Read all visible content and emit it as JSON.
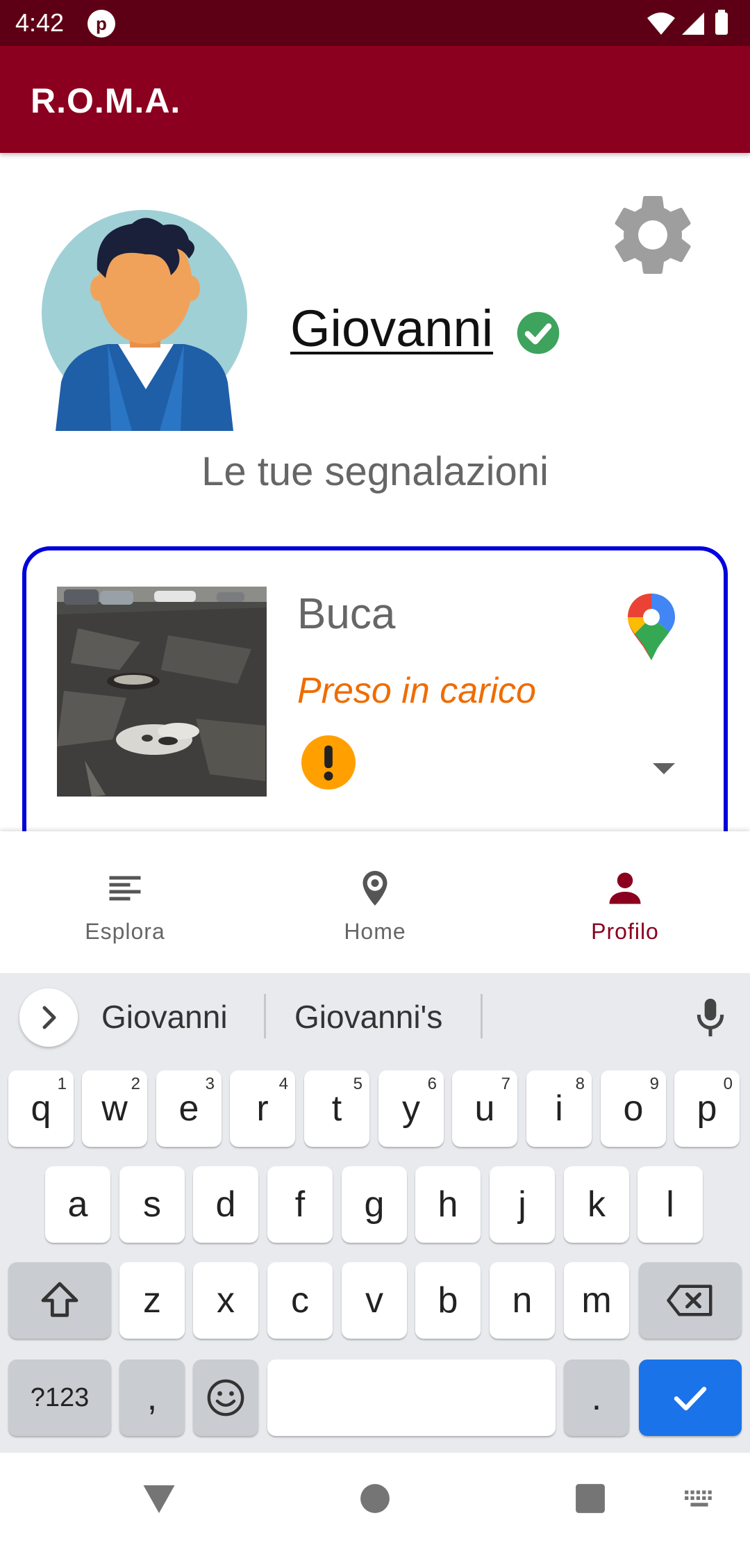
{
  "status_bar": {
    "time": "4:42",
    "app_icon_letter": "p"
  },
  "app_bar": {
    "title": "R.O.M.A."
  },
  "profile": {
    "name": "Giovanni",
    "verified_icon": "check-circle-icon",
    "settings_icon": "gear-icon",
    "section_title": "Le tue segnalazioni"
  },
  "reports": [
    {
      "type": "Buca",
      "status": "Preso in carico",
      "status_color": "#ef6c00",
      "priority_icon": "exclamation-circle-icon",
      "map_icon": "google-maps-pin-icon"
    }
  ],
  "bottom_nav": {
    "items": [
      {
        "label": "Esplora",
        "icon": "list-icon",
        "active": false
      },
      {
        "label": "Home",
        "icon": "location-pin-icon",
        "active": false
      },
      {
        "label": "Profilo",
        "icon": "person-icon",
        "active": true
      }
    ],
    "active_color": "#8b001e"
  },
  "keyboard": {
    "suggestions": [
      "Giovanni",
      "Giovanni's"
    ],
    "row1": [
      {
        "key": "q",
        "hint": "1"
      },
      {
        "key": "w",
        "hint": "2"
      },
      {
        "key": "e",
        "hint": "3"
      },
      {
        "key": "r",
        "hint": "4"
      },
      {
        "key": "t",
        "hint": "5"
      },
      {
        "key": "y",
        "hint": "6"
      },
      {
        "key": "u",
        "hint": "7"
      },
      {
        "key": "i",
        "hint": "8"
      },
      {
        "key": "o",
        "hint": "9"
      },
      {
        "key": "p",
        "hint": "0"
      }
    ],
    "row2": [
      "a",
      "s",
      "d",
      "f",
      "g",
      "h",
      "j",
      "k",
      "l"
    ],
    "row3": [
      "z",
      "x",
      "c",
      "v",
      "b",
      "n",
      "m"
    ],
    "symbols_label": "?123",
    "comma": ",",
    "period": "."
  },
  "colors": {
    "app_bar": "#8b001e",
    "status_bar": "#5e0015",
    "card_border": "#0000dd",
    "enter_key": "#1a73e8"
  }
}
